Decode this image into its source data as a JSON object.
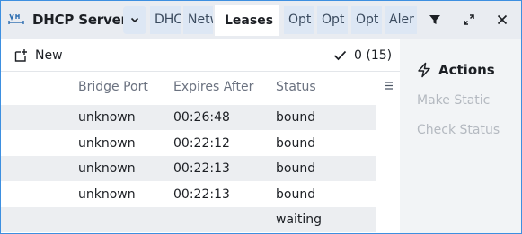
{
  "window": {
    "title": "DHCP Server",
    "tabs": [
      {
        "label": "DHC",
        "active": false
      },
      {
        "label": "Netw",
        "active": false
      },
      {
        "label": "Leases",
        "active": true
      },
      {
        "label": "Opt",
        "active": false
      },
      {
        "label": "Opt",
        "active": false
      },
      {
        "label": "Opt",
        "active": false
      },
      {
        "label": "Aler",
        "active": false
      }
    ],
    "icons": [
      "dhcp-app-icon",
      "chevron-down-icon",
      "filter-icon",
      "restore-icon",
      "close-icon"
    ]
  },
  "toolbar": {
    "new_label": "New",
    "count_label": "0 (15)"
  },
  "table": {
    "columns": [
      "Bridge Port",
      "Expires After",
      "Status"
    ],
    "rows": [
      {
        "bridge_port": "unknown",
        "expires_after": "00:26:48",
        "status": "bound"
      },
      {
        "bridge_port": "unknown",
        "expires_after": "00:22:12",
        "status": "bound"
      },
      {
        "bridge_port": "unknown",
        "expires_after": "00:22:13",
        "status": "bound"
      },
      {
        "bridge_port": "unknown",
        "expires_after": "00:22:13",
        "status": "bound"
      },
      {
        "bridge_port": "",
        "expires_after": "",
        "status": "waiting"
      }
    ]
  },
  "actions": {
    "title": "Actions",
    "items": [
      "Make Static",
      "Check Status"
    ]
  },
  "colors": {
    "accent_border": "#3d8fe0",
    "titlebar_bg": "#e9ecf1",
    "tab_bg": "#dde7f4",
    "row_shade": "#eceef1",
    "disabled_text": "#b4b9c0"
  }
}
